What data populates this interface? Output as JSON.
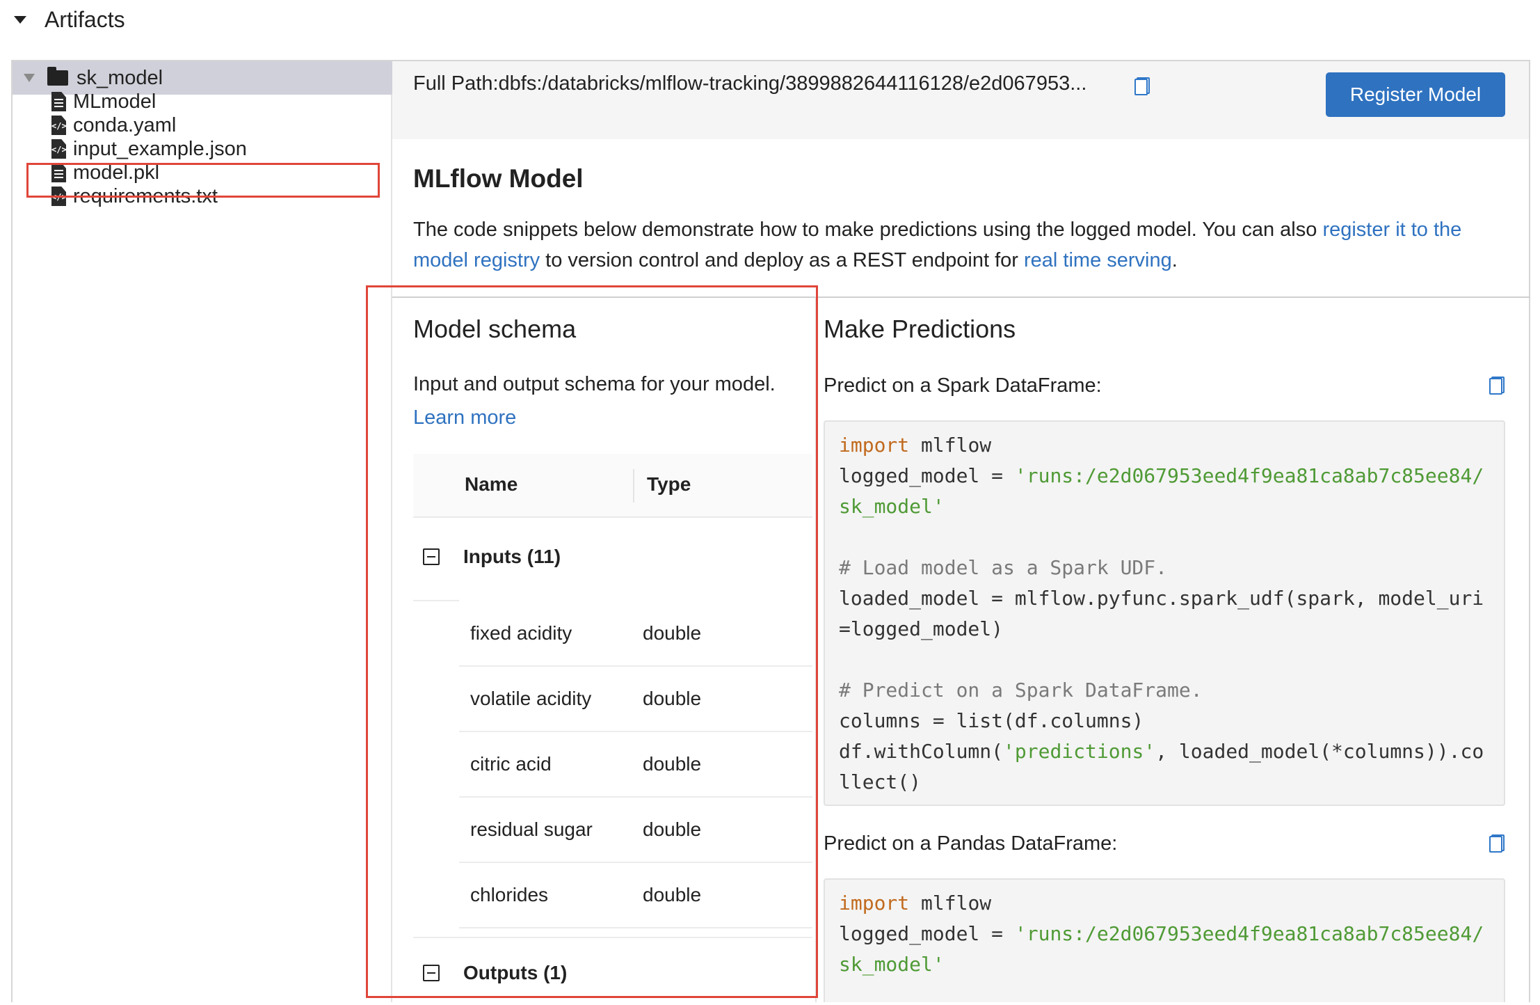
{
  "header": {
    "title": "Artifacts"
  },
  "tree": {
    "root": "sk_model",
    "files": [
      {
        "name": "MLmodel",
        "icon": "text-file-icon"
      },
      {
        "name": "conda.yaml",
        "icon": "code-file-icon"
      },
      {
        "name": "input_example.json",
        "icon": "code-file-icon"
      },
      {
        "name": "model.pkl",
        "icon": "text-file-icon"
      },
      {
        "name": "requirements.txt",
        "icon": "code-file-icon"
      }
    ]
  },
  "path_bar": {
    "full_path": "Full Path:dbfs:/databricks/mlflow-tracking/3899882644116128/e2d067953...",
    "register_label": "Register Model"
  },
  "mlflow": {
    "title": "MLflow Model",
    "desc_1": "The code snippets below demonstrate how to make predictions using the logged model. You can also ",
    "link_registry": "register it to the model registry",
    "desc_2": " to version control and deploy as a REST endpoint for ",
    "link_serving": "real time serving",
    "desc_3": "."
  },
  "schema": {
    "title": "Model schema",
    "description": "Input and output schema for your model.",
    "learn_more": "Learn more",
    "col_name": "Name",
    "col_type": "Type",
    "inputs_label": "Inputs (11)",
    "outputs_label": "Outputs (1)",
    "fields": [
      {
        "name": "fixed acidity",
        "type": "double"
      },
      {
        "name": "volatile acidity",
        "type": "double"
      },
      {
        "name": "citric acid",
        "type": "double"
      },
      {
        "name": "residual sugar",
        "type": "double"
      },
      {
        "name": "chlorides",
        "type": "double"
      }
    ]
  },
  "predictions": {
    "title": "Make Predictions",
    "spark_label": "Predict on a Spark DataFrame:",
    "pandas_label": "Predict on a Pandas DataFrame:",
    "code": {
      "import_kw": "import",
      "import_rest": " mlflow",
      "logged_prefix": "logged_model = ",
      "run_str_1": "'runs:/e2d067953eed4f9ea81ca8ab7c85ee84/",
      "run_str_2": "sk_model'",
      "spark_comment_1": "# Load model as a Spark UDF.",
      "spark_line_1": "loaded_model = mlflow.pyfunc.spark_udf(spark, model_uri",
      "spark_line_2": "=logged_model)",
      "spark_comment_2": "# Predict on a Spark DataFrame.",
      "spark_line_3": "columns = list(df.columns)",
      "spark_line_4a": "df.withColumn(",
      "spark_line_4str": "'predictions'",
      "spark_line_4b": ", loaded_model(*columns)).co",
      "spark_line_5": "llect()"
    }
  },
  "colors": {
    "accent": "#2f72c0",
    "highlight": "#e0463a",
    "keyword": "#c16a1e",
    "string": "#4f9a35"
  }
}
